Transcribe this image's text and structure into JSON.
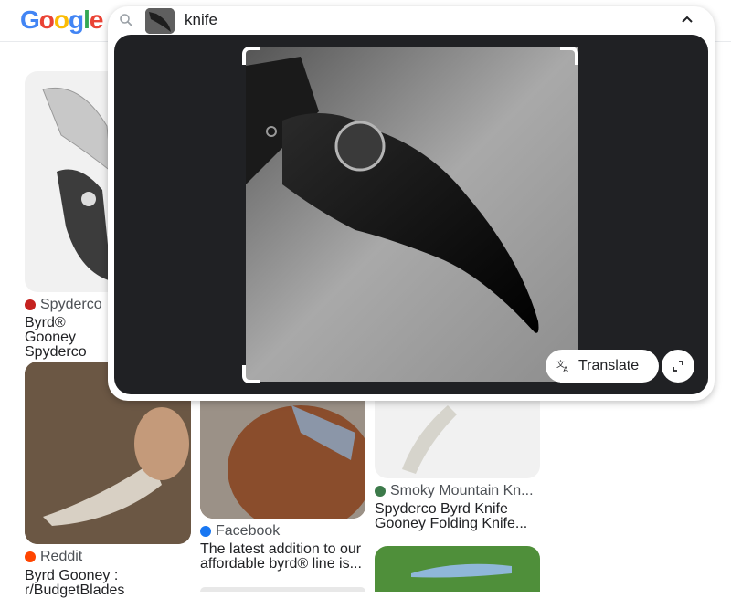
{
  "header": {
    "logo_letters": [
      {
        "ch": "G",
        "color": "#4285f4"
      },
      {
        "ch": "o",
        "color": "#ea4335"
      },
      {
        "ch": "o",
        "color": "#fbbc05"
      },
      {
        "ch": "g",
        "color": "#4285f4"
      },
      {
        "ch": "l",
        "color": "#34a853"
      },
      {
        "ch": "e",
        "color": "#ea4335"
      }
    ]
  },
  "search": {
    "query": "knife"
  },
  "viewer": {
    "translate_label": "Translate"
  },
  "results": [
    {
      "source": "Spyderco",
      "title": "Byrd® Gooney Spyderco",
      "favicon_color": "#c5221f"
    },
    {
      "source": "Reddit",
      "title": "Byrd Gooney : r/BudgetBlades",
      "favicon_color": "#ff4500"
    },
    {
      "source": "Facebook",
      "title": "The latest addition to our affordable byrd® line is...",
      "favicon_color": "#1877f2"
    },
    {
      "source": "Smoky Mountain Kn...",
      "title": "Spyderco Byrd Knife Gooney Folding Knife...",
      "favicon_color": "#3c7a4a"
    }
  ],
  "colors": {
    "accent": "#1a73e8",
    "viewer_bg": "#202124"
  }
}
